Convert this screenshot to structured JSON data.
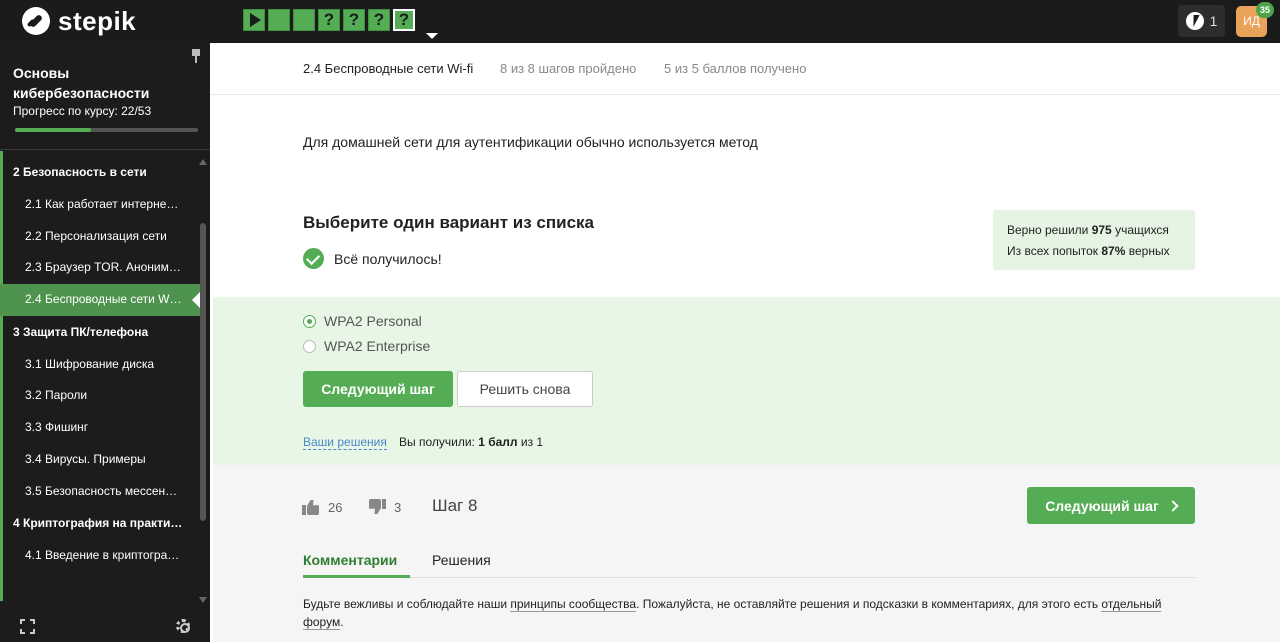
{
  "topbar": {
    "logo_text": "stepik",
    "steps": [
      "",
      "",
      "",
      "?",
      "?",
      "?",
      "?"
    ],
    "energy_count": "1",
    "avatar_initials": "ИД",
    "avatar_badge": "35"
  },
  "sidebar": {
    "course_title": "Основы кибербезопасности",
    "progress_label": "Прогресс по курсу:  22/53",
    "progress_fraction": 0.415,
    "modules": [
      {
        "label": "2  Безопасность в сети",
        "lessons": [
          {
            "label": "2.1  Как работает интерне…"
          },
          {
            "label": "2.2  Персонализация сети"
          },
          {
            "label": "2.3  Браузер TOR. Аноним…"
          },
          {
            "label": "2.4  Беспроводные сети W…",
            "active": true
          }
        ]
      },
      {
        "label": "3  Защита ПК/телефона",
        "lessons": [
          {
            "label": "3.1  Шифрование диска"
          },
          {
            "label": "3.2  Пароли"
          },
          {
            "label": "3.3  Фишинг"
          },
          {
            "label": "3.4  Вирусы. Примеры"
          },
          {
            "label": "3.5  Безопасность мессен…"
          }
        ]
      },
      {
        "label": "4  Криптография на практи…",
        "lessons": [
          {
            "label": "4.1  Введение в криптогра…"
          }
        ]
      }
    ]
  },
  "header": {
    "lesson_title": "2.4 Беспроводные сети Wi-fi",
    "steps_passed": "8 из 8 шагов пройдено",
    "points": "5 из 5 баллов  получено"
  },
  "quiz": {
    "question": "Для домашней сети для аутентификации обычно используется метод",
    "title": "Выберите один вариант из списка",
    "success_text": "Всё получилось!",
    "stats": {
      "line1_prefix": "Верно решили ",
      "line1_value": "975",
      "line1_suffix": " учащихся",
      "line2_prefix": "Из всех попыток ",
      "line2_value": "87%",
      "line2_suffix": " верных"
    },
    "options": [
      {
        "label": "WPA2 Personal",
        "checked": true
      },
      {
        "label": "WPA2 Enterprise",
        "checked": false
      }
    ],
    "next_button": "Следующий шаг",
    "retry_button": "Решить снова",
    "your_solutions_link": "Ваши решения",
    "got_prefix": "Вы получили: ",
    "got_value": "1 балл",
    "got_suffix": " из 1"
  },
  "footer": {
    "likes": "26",
    "dislikes": "3",
    "step_label": "Шаг 8",
    "next_button": "Следующий шаг",
    "tabs": [
      "Комментарии",
      "Решения"
    ],
    "notice_part1": "Будьте вежливы и соблюдайте наши ",
    "notice_link1": "принципы сообщества",
    "notice_part2": ". Пожалуйста, не оставляйте решения и подсказки в комментариях, для этого есть ",
    "notice_link2": "отдельный форум",
    "notice_part3": "."
  }
}
